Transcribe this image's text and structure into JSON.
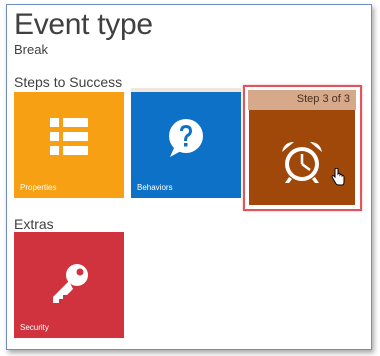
{
  "header": {
    "title": "Event type",
    "subtitle": "Break"
  },
  "sections": {
    "steps_label": "Steps to Success",
    "extras_label": "Extras"
  },
  "tiles": {
    "properties": {
      "label": "Properties",
      "icon": "list-icon",
      "color": "#f7a014"
    },
    "behaviors": {
      "label": "Behaviors",
      "icon": "question-bubble-icon",
      "color": "#0d72c7"
    },
    "break_step": {
      "step_text": "Step 3 of 3",
      "icon": "alarm-clock-icon",
      "color": "#a0480a",
      "selected": true
    },
    "security": {
      "label": "Security",
      "icon": "key-icon",
      "color": "#d0333d"
    }
  },
  "colors": {
    "selection_border": "#e0555c",
    "step_bar": "#d6a98a"
  }
}
